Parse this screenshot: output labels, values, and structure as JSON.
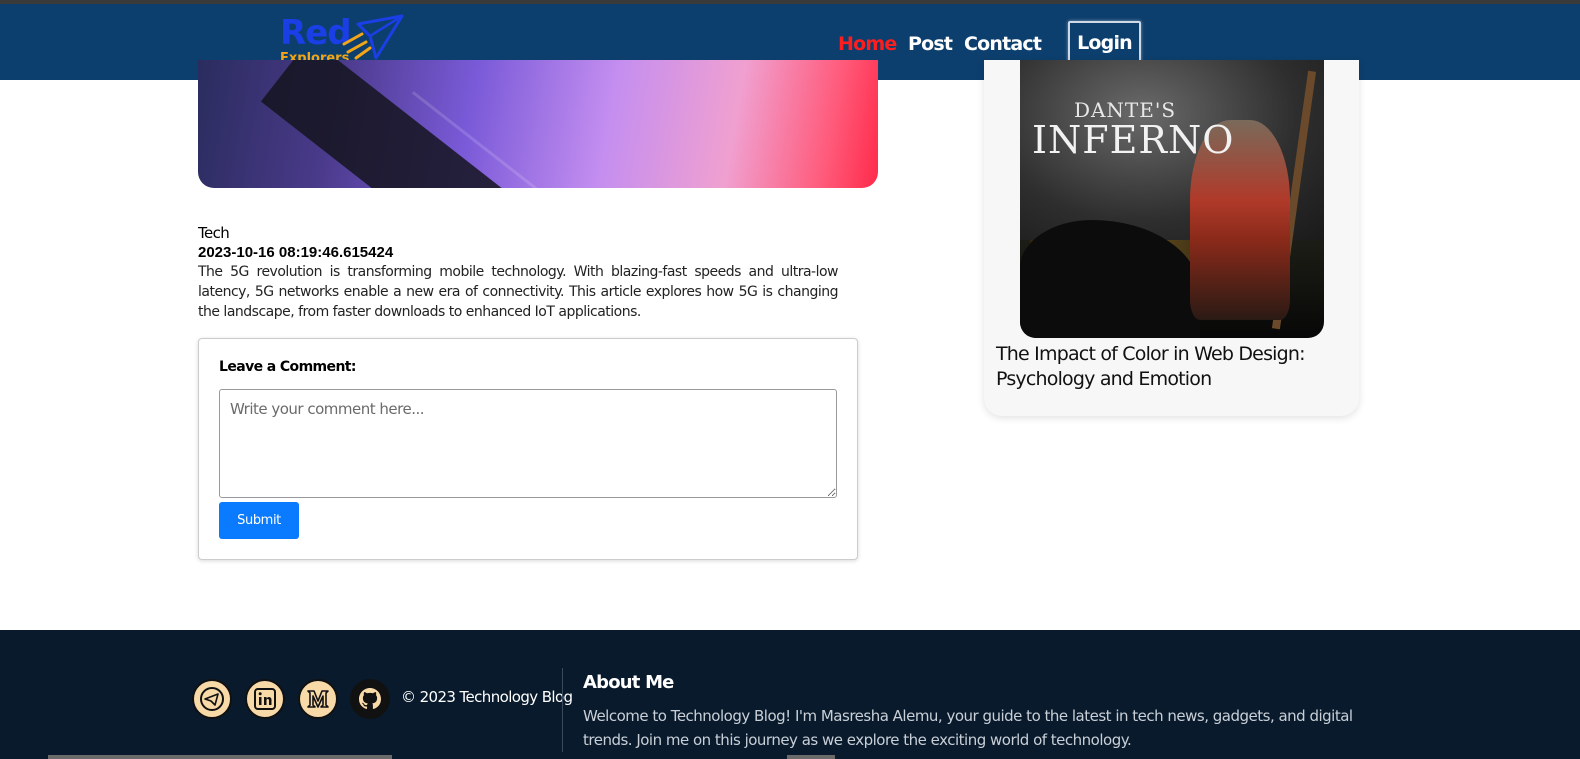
{
  "nav": {
    "logo_primary": "Red",
    "logo_secondary": "Explorers",
    "links": [
      "Home",
      "Post",
      "Contact"
    ],
    "login_label": "Login"
  },
  "post": {
    "category": "Tech",
    "date": "2023-10-16 08:19:46.615424",
    "body": "The 5G revolution is transforming mobile technology. With blazing-fast speeds and ultra-low latency, 5G networks enable a new era of connectivity. This article explores how 5G is changing the landscape, from faster downloads to enhanced IoT applications."
  },
  "comment": {
    "label": "Leave a Comment:",
    "placeholder": "Write your comment here...",
    "submit_label": "Submit"
  },
  "sidebar_card": {
    "image_text_top": "DANTE'S",
    "image_text_main": "INFERNO",
    "title": "The Impact of Color in Web Design: Psychology and Emotion"
  },
  "footer": {
    "social_icons": [
      "telegram-icon",
      "linkedin-icon",
      "medium-icon",
      "github-icon"
    ],
    "copyright": "© 2023 Technology Blog",
    "about_heading": "About Me",
    "about_text": "Welcome to Technology Blog! I'm Masresha Alemu, your guide to the latest in tech news, gadgets, and digital trends. Join me on this journey as we explore the exciting world of technology."
  },
  "colors": {
    "nav_bg": "#0d3f6e",
    "nav_active": "#ff1e1e",
    "submit_bg": "#0a7bff",
    "footer_bg": "#081a2c",
    "social_bg": "#f8d9a8"
  }
}
